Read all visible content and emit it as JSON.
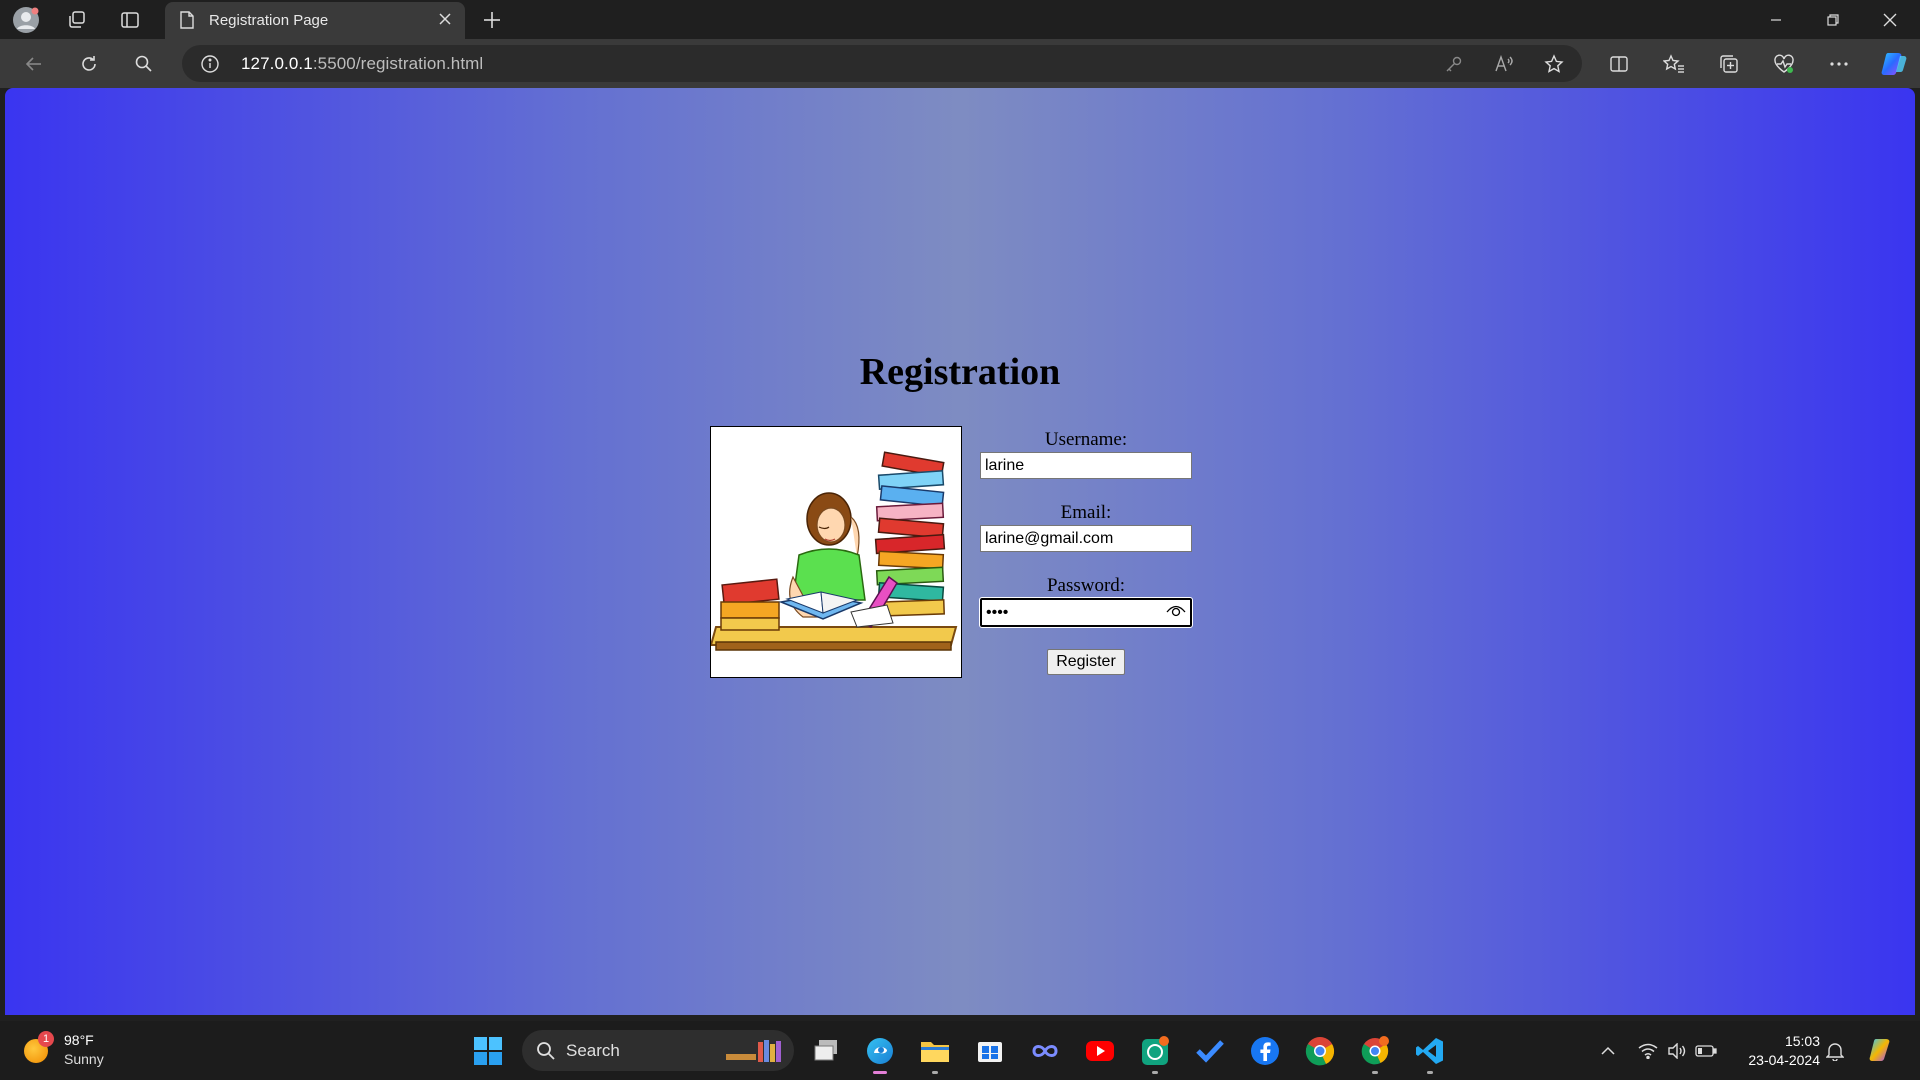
{
  "browser": {
    "tab_title": "Registration Page",
    "url_host": "127.0.0.1",
    "url_rest": ":5500/registration.html"
  },
  "page": {
    "title": "Registration",
    "username_label": "Username:",
    "username_value": "larine",
    "email_label": "Email:",
    "email_value": "larine@gmail.com",
    "password_label": "Password:",
    "password_value": "••••",
    "register_label": "Register"
  },
  "taskbar": {
    "weather_temp": "98°F",
    "weather_cond": "Sunny",
    "weather_badge": "1",
    "search_label": "Search",
    "time": "15:03",
    "date": "23-04-2024"
  },
  "colors": {
    "gradient_edge": "#3a35f0",
    "gradient_center": "#7e8cc2"
  }
}
